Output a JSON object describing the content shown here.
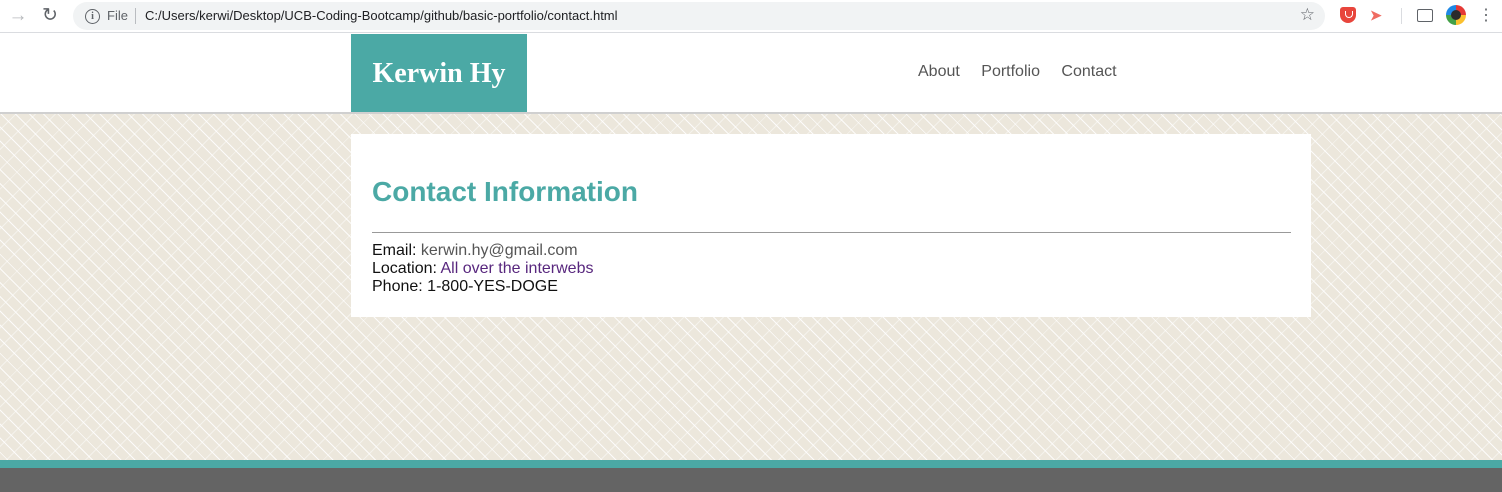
{
  "browser": {
    "scheme_label": "File",
    "url": "C:/Users/kerwi/Desktop/UCB-Coding-Bootcamp/github/basic-portfolio/contact.html",
    "icons": [
      "forward-icon",
      "reload-icon",
      "info-icon",
      "star-icon",
      "shield-extension-icon",
      "arrow-extension-icon",
      "cast-icon",
      "profile-avatar",
      "menu-icon"
    ]
  },
  "site": {
    "logo": "Kerwin Hy",
    "nav": [
      "About",
      "Portfolio",
      "Contact"
    ],
    "colors": {
      "accent": "#4ba9a5",
      "footer": "#646464",
      "background": "#ece7dc"
    }
  },
  "contact": {
    "title": "Contact Information",
    "email_label": "Email:",
    "email_value": "kerwin.hy@gmail.com",
    "location_label": "Location:",
    "location_value": "All over the interwebs",
    "phone_label": "Phone:",
    "phone_value": "1-800-YES-DOGE"
  }
}
